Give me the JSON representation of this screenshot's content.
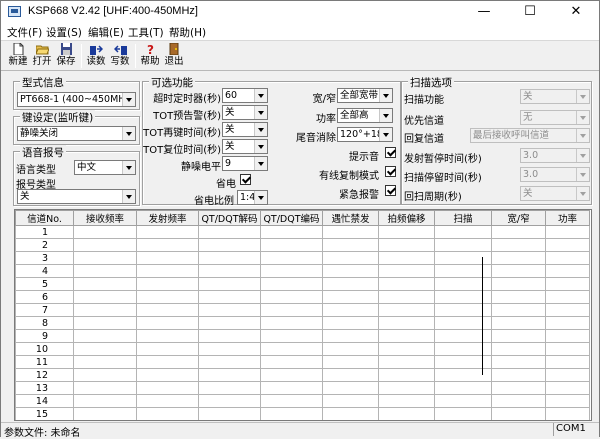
{
  "window": {
    "title": "KSP668 V2.42    [UHF:400-450MHz]"
  },
  "menu": [
    "文件(F)",
    "设置(S)",
    "编辑(E)",
    "工具(T)",
    "帮助(H)"
  ],
  "toolbar": {
    "new": "新建",
    "open": "打开",
    "save": "保存",
    "read": "读数",
    "write": "写数",
    "help": "帮助",
    "exit": "退出"
  },
  "model": {
    "title": "型式信息",
    "value": "PT668-1 (400~450MHz)"
  },
  "key": {
    "title": "键设定(监听键)",
    "value": "静噪关闭"
  },
  "voice": {
    "title": "语音报号",
    "lang_label": "语言类型",
    "lang_value": "中文",
    "report_label": "报号类型",
    "report_value": "关"
  },
  "optional": {
    "title": "可选功能",
    "timeout_label": "超时定时器(秒)",
    "timeout_value": "60",
    "tot_pre_label": "TOT预告警(秒)",
    "tot_pre_value": "关",
    "tot_rekey_label": "TOT再键时间(秒)",
    "tot_rekey_value": "关",
    "tot_reset_label": "TOT复位时间(秒)",
    "tot_reset_value": "关",
    "squelch_label": "静噪电平",
    "squelch_value": "9",
    "power_save_label": "省电",
    "power_save_ratio_label": "省电比例",
    "power_save_ratio_value": "1:4",
    "bw_label": "宽/窄",
    "bw_value": "全部宽带",
    "power_label": "功率",
    "power_value": "全部高",
    "tail_label": "尾音消除",
    "tail_value": "120°+180°",
    "beep_label": "提示音",
    "clone_label": "有线复制模式",
    "alarm_label": "紧急报警"
  },
  "scan": {
    "title": "扫描选项",
    "function_label": "扫描功能",
    "function_value": "关",
    "priority_label": "优先信道",
    "priority_value": "无",
    "revert_label": "回复信道",
    "revert_value": "最后接收呼叫信道",
    "tx_pause_label": "发射暂停时间(秒)",
    "tx_pause_value": "3.0",
    "dwell_label": "扫描停留时间(秒)",
    "dwell_value": "3.0",
    "return_label": "回扫周期(秒)",
    "return_value": "关"
  },
  "table": {
    "headers": [
      "信道No.",
      "接收频率",
      "发射频率",
      "QT/DQT解码",
      "QT/DQT编码",
      "遇忙禁发",
      "拍频偏移",
      "扫描",
      "宽/窄",
      "功率"
    ],
    "rows": [
      "1",
      "2",
      "3",
      "4",
      "5",
      "6",
      "7",
      "8",
      "9",
      "10",
      "11",
      "12",
      "13",
      "14",
      "15",
      "16"
    ]
  },
  "status": {
    "file": "参数文件: 未命名",
    "port": "COM1"
  }
}
